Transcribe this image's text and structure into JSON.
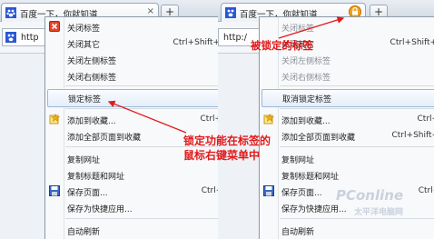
{
  "left": {
    "tab": {
      "title": "百度一下，你就知道",
      "close": "×"
    },
    "new_tab": "+",
    "url": "http",
    "menu": {
      "items": [
        {
          "label": "关闭标签",
          "shortcut": "",
          "icon": "close-tab-icon"
        },
        {
          "label": "关闭其它",
          "shortcut": "Ctrl+Shift+W"
        },
        {
          "label": "关闭左侧标签",
          "shortcut": ""
        },
        {
          "label": "关闭右侧标签",
          "shortcut": ""
        },
        {
          "label": "锁定标签",
          "shortcut": "",
          "highlighted": true
        },
        {
          "label": "添加到收藏...",
          "shortcut": "Ctrl+D",
          "icon": "favorite-star-icon"
        },
        {
          "label": "添加全部页面到收藏",
          "shortcut": ""
        },
        {
          "label": "复制网址",
          "shortcut": ""
        },
        {
          "label": "复制标题和网址",
          "shortcut": ""
        },
        {
          "label": "保存页面...",
          "shortcut": "Ctrl+S",
          "icon": "floppy-disk-icon"
        },
        {
          "label": "保存为快捷应用...",
          "shortcut": ""
        },
        {
          "label": "自动刷新",
          "shortcut": "▶"
        }
      ]
    }
  },
  "right": {
    "tab": {
      "title": "百度一下，你就知道",
      "locked": true
    },
    "new_tab": "+",
    "url": "http:/",
    "menu": {
      "items": [
        {
          "label": "关闭标签",
          "shortcut": ""
        },
        {
          "label": "关闭其它",
          "shortcut": "Ctrl+Shift+W"
        },
        {
          "label": "关闭左侧标签",
          "shortcut": ""
        },
        {
          "label": "关闭右侧标签",
          "shortcut": ""
        },
        {
          "label": "取消锁定标签",
          "shortcut": "",
          "highlighted": true
        },
        {
          "label": "添加到收藏...",
          "shortcut": "Ctrl+D",
          "icon": "favorite-star-icon"
        },
        {
          "label": "添加全部页面到收藏",
          "shortcut": "Ctrl+Shift+D"
        },
        {
          "label": "复制网址",
          "shortcut": ""
        },
        {
          "label": "复制标题和网址",
          "shortcut": ""
        },
        {
          "label": "保存页面...",
          "shortcut": "Ctrl+S",
          "icon": "floppy-disk-icon"
        },
        {
          "label": "保存为快捷应用...",
          "shortcut": ""
        },
        {
          "label": "自动刷新",
          "shortcut": ""
        }
      ]
    }
  },
  "annotations": {
    "locked_tab": "被锁定的标签",
    "menu_line1": "锁定功能在标签的",
    "menu_line2": "鼠标右键菜单中"
  },
  "watermark": {
    "brand": "PConline",
    "sub": "太平洋电脑网"
  },
  "colors": {
    "annotation": "#e11a1a",
    "lock_badge": "#f0a21c",
    "highlight_border": "#9db7d4"
  }
}
